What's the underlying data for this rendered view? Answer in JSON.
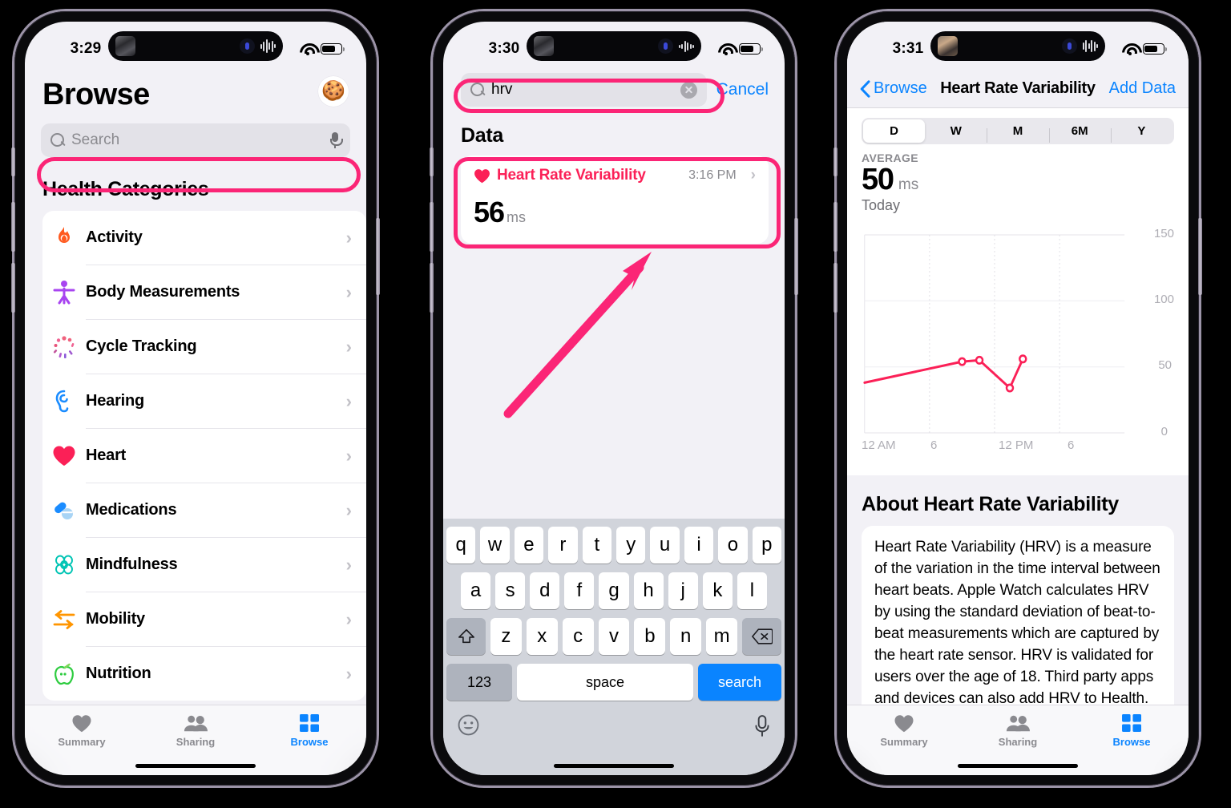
{
  "accent": {
    "pink": "#fb2576",
    "blue": "#0a84ff",
    "red": "#fb2057"
  },
  "phone1": {
    "status": {
      "time": "3:29"
    },
    "page_title": "Browse",
    "avatar_icon": "gingerbread-man-avatar",
    "search": {
      "placeholder": "Search",
      "icon": "search-icon",
      "mic_icon": "microphone-icon"
    },
    "section_title": "Health Categories",
    "categories": [
      {
        "label": "Activity",
        "icon": "flame-icon",
        "color": "#ff5a1f"
      },
      {
        "label": "Body Measurements",
        "icon": "body-figure-icon",
        "color": "#a845f0"
      },
      {
        "label": "Cycle Tracking",
        "icon": "cycle-burst-icon",
        "color": "#f06292"
      },
      {
        "label": "Hearing",
        "icon": "ear-icon",
        "color": "#1a8cff"
      },
      {
        "label": "Heart",
        "icon": "heart-icon",
        "color": "#fb2057"
      },
      {
        "label": "Medications",
        "icon": "pills-icon",
        "color": "#1a8cff"
      },
      {
        "label": "Mindfulness",
        "icon": "brain-icon",
        "color": "#00c4b4"
      },
      {
        "label": "Mobility",
        "icon": "arrows-icon",
        "color": "#ff9500"
      },
      {
        "label": "Nutrition",
        "icon": "apple-icon",
        "color": "#2ecc40"
      }
    ],
    "tabs": [
      {
        "label": "Summary",
        "icon": "heart-icon",
        "active": false
      },
      {
        "label": "Sharing",
        "icon": "people-icon",
        "active": false
      },
      {
        "label": "Browse",
        "icon": "grid-icon",
        "active": true
      }
    ]
  },
  "phone2": {
    "status": {
      "time": "3:30"
    },
    "search": {
      "value": "hrv",
      "icon": "search-icon",
      "clear_icon": "clear-circle-icon"
    },
    "cancel_label": "Cancel",
    "section_title": "Data",
    "result": {
      "icon": "heart-icon",
      "title": "Heart Rate Variability",
      "time": "3:16 PM",
      "value": "56",
      "unit": "ms",
      "chevron": "chevron-right-icon"
    },
    "keyboard": {
      "row1": [
        "q",
        "w",
        "e",
        "r",
        "t",
        "y",
        "u",
        "i",
        "o",
        "p"
      ],
      "row2": [
        "a",
        "s",
        "d",
        "f",
        "g",
        "h",
        "j",
        "k",
        "l"
      ],
      "row3": [
        "z",
        "x",
        "c",
        "v",
        "b",
        "n",
        "m"
      ],
      "shift_icon": "shift-up-icon",
      "backspace_icon": "backspace-icon",
      "numbers_label": "123",
      "space_label": "space",
      "go_label": "search",
      "emoji_icon": "emoji-smiley-icon",
      "mic_icon": "microphone-icon"
    }
  },
  "phone3": {
    "status": {
      "time": "3:31"
    },
    "nav": {
      "back_label": "Browse",
      "back_icon": "chevron-left-icon",
      "title": "Heart Rate Variability",
      "action_label": "Add Data"
    },
    "ranges": [
      {
        "label": "D",
        "active": true
      },
      {
        "label": "W",
        "active": false
      },
      {
        "label": "M",
        "active": false
      },
      {
        "label": "6M",
        "active": false
      },
      {
        "label": "Y",
        "active": false
      }
    ],
    "average_label": "AVERAGE",
    "average_value": "50",
    "average_unit": "ms",
    "average_day": "Today",
    "about_title": "About Heart Rate Variability",
    "about_text": "Heart Rate Variability (HRV) is a measure of the variation in the time interval between heart beats. Apple Watch calculates HRV by using the standard deviation of beat-to-beat measurements which are captured by the heart rate sensor. HRV is validated for users over the age of 18. Third party apps and devices can also add HRV to Health.",
    "tabs": [
      {
        "label": "Summary",
        "icon": "heart-icon",
        "active": false
      },
      {
        "label": "Sharing",
        "icon": "people-icon",
        "active": false
      },
      {
        "label": "Browse",
        "icon": "grid-icon",
        "active": true
      }
    ]
  },
  "chart_data": {
    "type": "line",
    "title": "Today",
    "xlabel": "",
    "ylabel": "ms",
    "xlim": [
      0,
      24
    ],
    "ylim": [
      0,
      150
    ],
    "yticks": [
      0,
      50,
      100,
      150
    ],
    "xticks": [
      0,
      6,
      12,
      18
    ],
    "xtick_labels": [
      "12 AM",
      "6",
      "12 PM",
      "6"
    ],
    "grid": true,
    "line_color": "#fb2057",
    "series": [
      {
        "name": "Heart Rate Variability",
        "x": [
          0,
          9.0,
          10.6,
          13.4,
          14.6
        ],
        "y": [
          38,
          54,
          55,
          34,
          56
        ],
        "markers": [
          false,
          true,
          true,
          true,
          true
        ]
      }
    ]
  },
  "annotations": {
    "arrow_color": "#fb2576",
    "highlight_color": "#fb2576"
  }
}
